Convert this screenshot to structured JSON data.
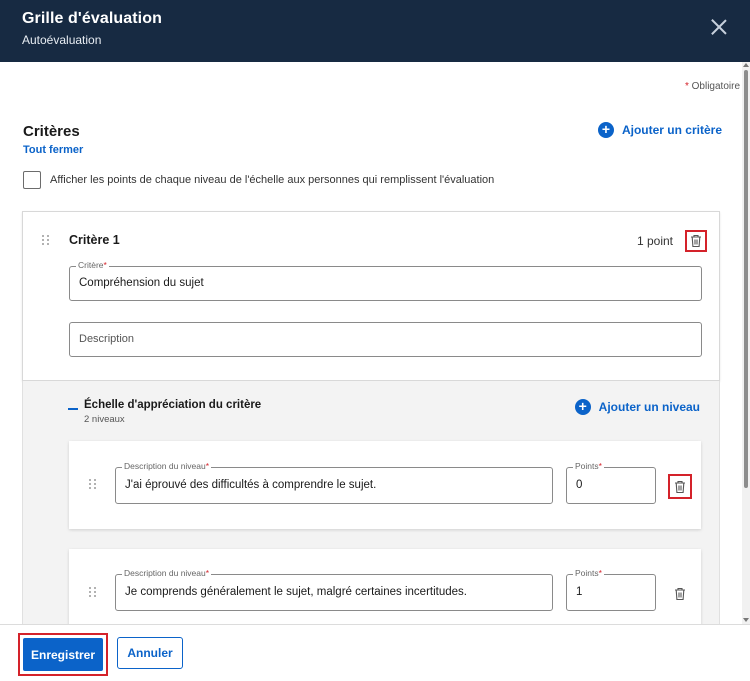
{
  "header": {
    "title": "Grille d'évaluation",
    "subtitle": "Autoévaluation"
  },
  "required_note": {
    "star": "*",
    "label": "Obligatoire"
  },
  "criteria_section": {
    "title": "Critères",
    "collapse_all": "Tout fermer",
    "add_criterion": "Ajouter un critère",
    "show_points_checkbox": {
      "label": "Afficher les points de chaque niveau de l'échelle aux personnes qui remplissent l'évaluation",
      "checked": false
    }
  },
  "criterion": {
    "title": "Critère 1",
    "points": "1 point",
    "name_field": {
      "legend": "Critère",
      "value": "Compréhension du sujet"
    },
    "description_field": {
      "placeholder": "Description"
    }
  },
  "scale": {
    "title": "Échelle d'appréciation du critère",
    "subtitle": "2 niveaux",
    "add_level": "Ajouter un niveau",
    "levels": [
      {
        "description_legend": "Description du niveau",
        "description": "J'ai éprouvé des difficultés à comprendre le sujet.",
        "points_legend": "Points",
        "points": "0"
      },
      {
        "description_legend": "Description du niveau",
        "description": "Je comprends généralement le sujet, malgré certaines incertitudes.",
        "points_legend": "Points",
        "points": "1"
      }
    ]
  },
  "footer": {
    "save_label": "Enregistrer",
    "cancel_label": "Annuler"
  },
  "colors": {
    "header_bg": "#172a42",
    "accent": "#0b63c9",
    "required": "#d4222a"
  },
  "icons": {
    "close": "close-icon",
    "plus": "plus-circle-icon",
    "trash": "trash-icon",
    "drag": "drag-handle-icon"
  }
}
